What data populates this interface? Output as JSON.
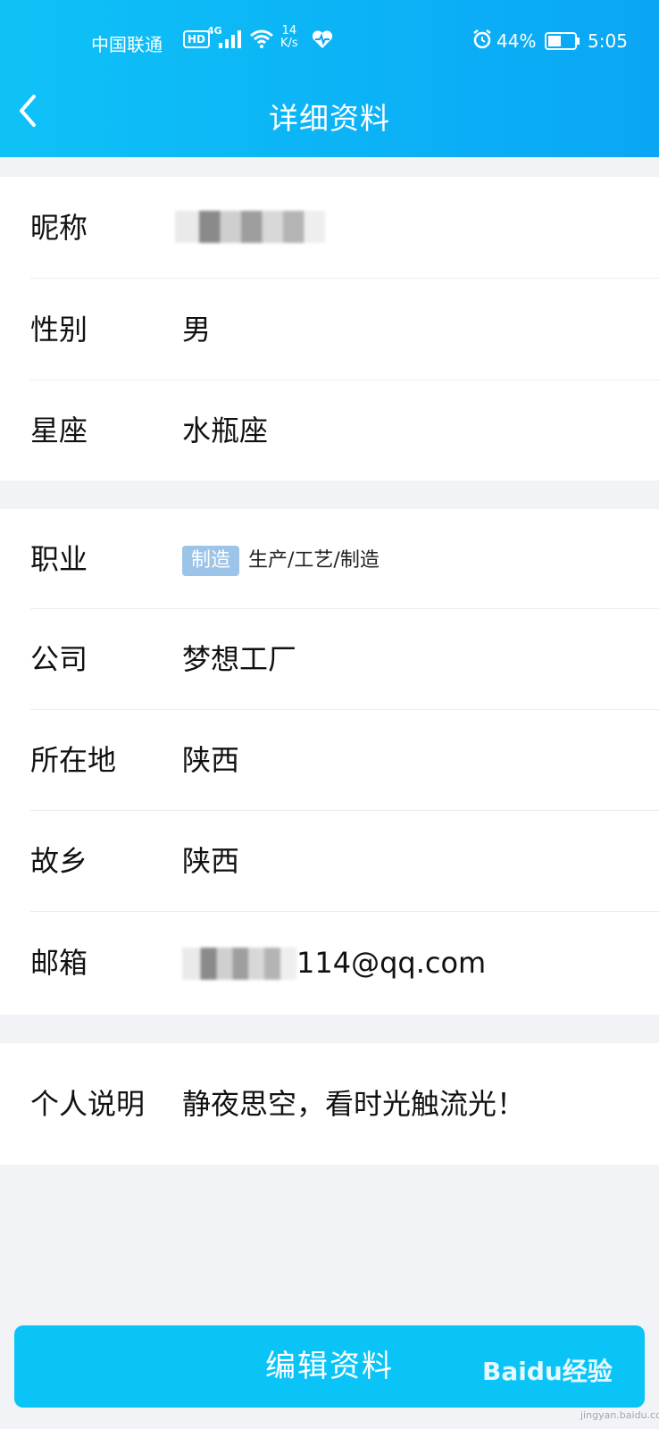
{
  "status_bar": {
    "carrier": "中国联通",
    "hd": "HD",
    "network": "4G",
    "speed_value": "14",
    "speed_unit": "K/s",
    "battery_percent": "44%",
    "time": "5:05"
  },
  "header": {
    "title": "详细资料"
  },
  "basic": [
    {
      "label": "昵称",
      "value": ""
    },
    {
      "label": "性别",
      "value": "男"
    },
    {
      "label": "星座",
      "value": "水瓶座"
    }
  ],
  "details": {
    "occupation": {
      "label": "职业",
      "tag": "制造",
      "value": "生产/工艺/制造"
    },
    "company": {
      "label": "公司",
      "value": "梦想工厂"
    },
    "location": {
      "label": "所在地",
      "value": "陕西"
    },
    "hometown": {
      "label": "故乡",
      "value": "陕西"
    },
    "email": {
      "label": "邮箱",
      "value_visible": "114@qq.com"
    }
  },
  "bio": {
    "label": "个人说明",
    "value": "静夜思空，看时光触流光！"
  },
  "edit_button": "编辑资料",
  "watermark": {
    "brand": "Baidu经验",
    "url": "jingyan.baidu.com"
  },
  "colors": {
    "header_from": "#0ec2f7",
    "header_to": "#0aa6f5",
    "button": "#0bc4f7",
    "tag": "#9cc3e8"
  }
}
